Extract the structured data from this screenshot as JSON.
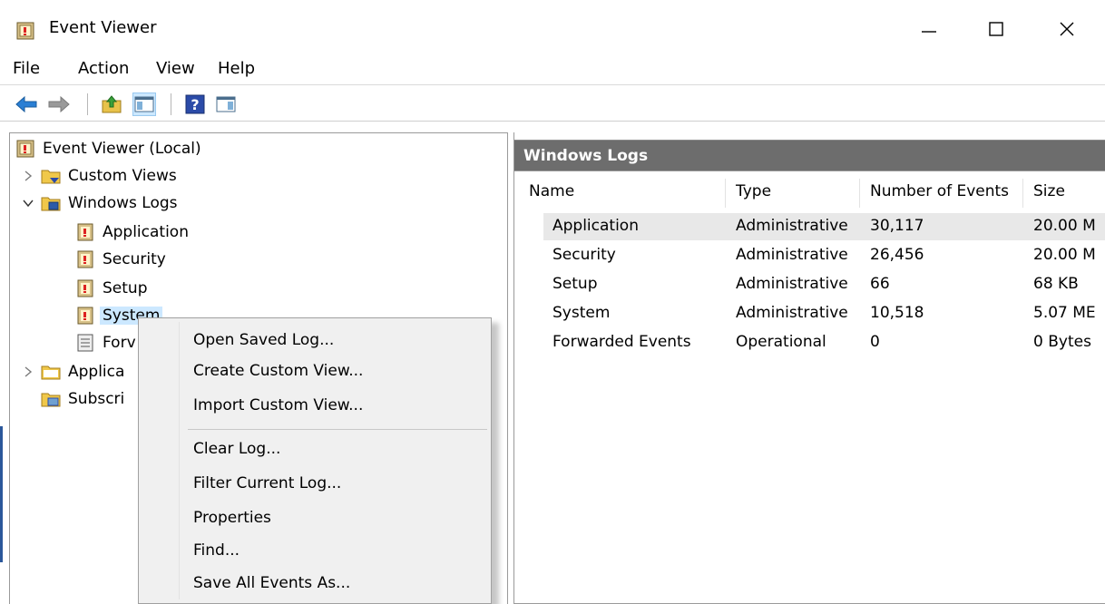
{
  "window": {
    "title": "Event Viewer",
    "icon": "event-viewer-icon",
    "controls": [
      "minimize-icon",
      "maximize-icon",
      "close-icon"
    ]
  },
  "menu": {
    "items": [
      "File",
      "Action",
      "View",
      "Help"
    ]
  },
  "toolbar": {
    "buttons": [
      "back-arrow-icon",
      "forward-arrow-icon",
      "up-folder-icon",
      "show-hide-console-tree-icon",
      "help-icon",
      "action-pane-icon"
    ]
  },
  "tree": {
    "root": "Event Viewer (Local)",
    "custom_views": "Custom Views",
    "windows_logs": "Windows Logs",
    "application": "Application",
    "security": "Security",
    "setup": "Setup",
    "system": "System",
    "forwarded_partial": "Forv",
    "applications_partial": "Applica",
    "subscriptions_partial": "Subscri"
  },
  "right_pane": {
    "header": "Windows Logs",
    "columns": [
      "Name",
      "Type",
      "Number of Events",
      "Size"
    ],
    "rows": [
      {
        "name": "Application",
        "type": "Administrative",
        "events": "30,117",
        "size": "20.00 M"
      },
      {
        "name": "Security",
        "type": "Administrative",
        "events": "26,456",
        "size": "20.00 M"
      },
      {
        "name": "Setup",
        "type": "Administrative",
        "events": "66",
        "size": "68 KB"
      },
      {
        "name": "System",
        "type": "Administrative",
        "events": "10,518",
        "size": "5.07 ME"
      },
      {
        "name": "Forwarded Events",
        "type": "Operational",
        "events": "0",
        "size": "0 Bytes"
      }
    ]
  },
  "context_menu": {
    "items": [
      "Open Saved Log...",
      "Create Custom View...",
      "Import Custom View...",
      "Clear Log...",
      "Filter Current Log...",
      "Properties",
      "Find...",
      "Save All Events As..."
    ]
  },
  "colors": {
    "header_bg": "#6d6d6d",
    "selection": "#cce8ff",
    "menu_bg": "#f0f0f0"
  }
}
